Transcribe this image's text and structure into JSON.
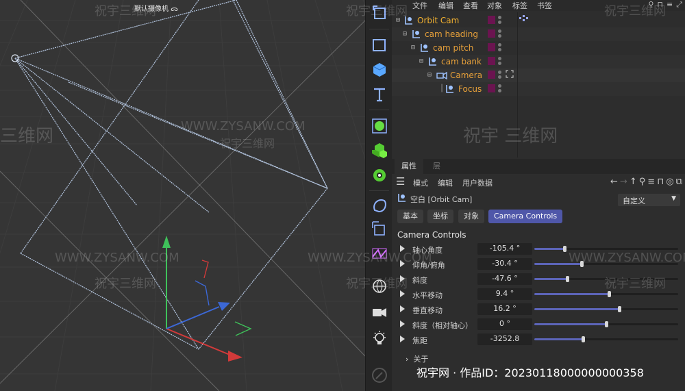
{
  "viewport": {
    "title": "默认摄像机 ᯅ"
  },
  "menubar": {
    "items": [
      "文件",
      "编辑",
      "查看",
      "对象",
      "标签",
      "书签"
    ],
    "icons": [
      "search-icon",
      "lock-icon",
      "filter-icon",
      "expand-icon"
    ]
  },
  "object_manager": {
    "objects": [
      {
        "name": "Orbit Cam",
        "icon": "null-icon"
      },
      {
        "name": "cam heading",
        "icon": "null-icon"
      },
      {
        "name": "cam pitch",
        "icon": "null-icon"
      },
      {
        "name": "cam bank",
        "icon": "null-icon"
      },
      {
        "name": "Camera",
        "icon": "camera-icon"
      },
      {
        "name": "Focus",
        "icon": "null-icon"
      }
    ],
    "layer_color": "#6b1450",
    "name_color": "#e8a13a"
  },
  "attributes": {
    "tabs": [
      "属性",
      "层"
    ],
    "menu": [
      "模式",
      "编辑",
      "用户数据"
    ],
    "object_title": "空白 [Orbit Cam]",
    "preset": "自定义",
    "subtabs": [
      "基本",
      "坐标",
      "对象",
      "Camera Controls"
    ],
    "section": "Camera Controls",
    "params": [
      {
        "label": "轴心角度",
        "value": "-105.4 °",
        "slider": 0.21
      },
      {
        "label": "仰角/俯角",
        "value": "-30.4 °",
        "slider": 0.33
      },
      {
        "label": "斜度",
        "value": "-47.6 °",
        "slider": 0.23
      },
      {
        "label": "水平移动",
        "value": "9.4 °",
        "slider": 0.52
      },
      {
        "label": "垂直移动",
        "value": "16.2 °",
        "slider": 0.59
      },
      {
        "label": "斜度（相对轴心）",
        "value": "0 °",
        "slider": 0.5
      },
      {
        "label": "焦距",
        "value": "-3252.8",
        "slider": 0.34
      }
    ],
    "about": "关于",
    "accent": "#4f57a9"
  },
  "watermarks": {
    "site": "WWW.ZYSANW.COM",
    "brand": "祝宇三维网",
    "brand_spaced": "祝宇 三维网",
    "short": "三维网",
    "prefix": "祝宇",
    "footer": "祝宇网 · 作品ID：20230118000000000358"
  }
}
